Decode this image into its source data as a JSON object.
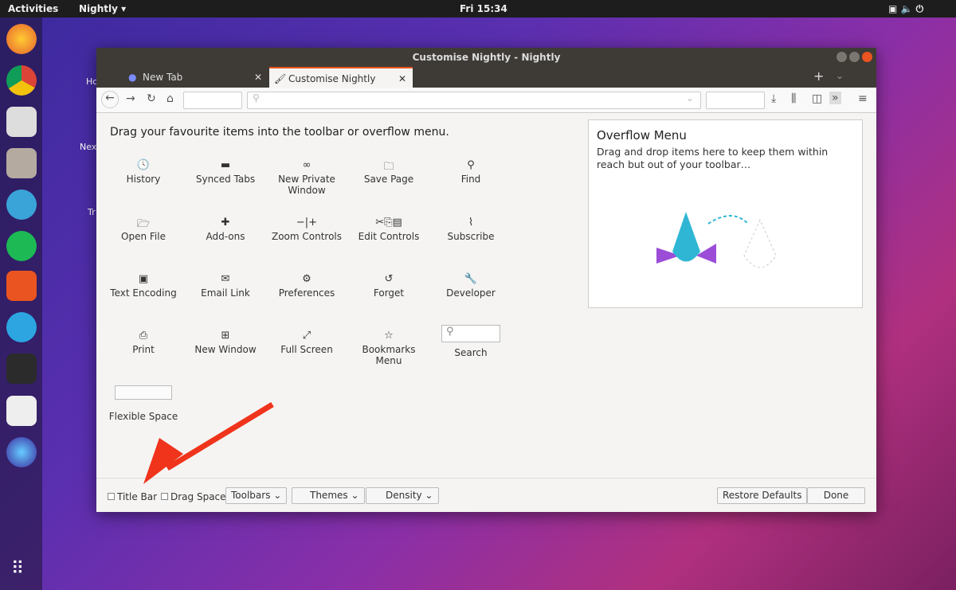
{
  "topbar": {
    "activities": "Activities",
    "app": "Nightly ▾",
    "clock": "Fri 15:34"
  },
  "desktop": {
    "home": "Ho",
    "next": "Nex",
    "trash": "Tr"
  },
  "window": {
    "title": "Customise Nightly - Nightly"
  },
  "tabs": [
    {
      "label": "New Tab"
    },
    {
      "label": "Customise Nightly"
    }
  ],
  "hint": "Drag your favourite items into the toolbar or overflow menu.",
  "items": [
    {
      "label": "History",
      "icon": "🕓"
    },
    {
      "label": "Synced Tabs",
      "icon": "▬"
    },
    {
      "label": "New Private Window",
      "icon": "∞"
    },
    {
      "label": "Save Page",
      "icon": "🗀"
    },
    {
      "label": "Find",
      "icon": "⚲"
    },
    {
      "label": "Open File",
      "icon": "🗁"
    },
    {
      "label": "Add-ons",
      "icon": "✚"
    },
    {
      "label": "Zoom Controls",
      "icon": "−|+"
    },
    {
      "label": "Edit Controls",
      "icon": "✂⎘▤"
    },
    {
      "label": "Subscribe",
      "icon": "⌇"
    },
    {
      "label": "Text Encoding",
      "icon": "▣"
    },
    {
      "label": "Email Link",
      "icon": "✉"
    },
    {
      "label": "Preferences",
      "icon": "⚙"
    },
    {
      "label": "Forget",
      "icon": "↺"
    },
    {
      "label": "Developer",
      "icon": "🔧"
    },
    {
      "label": "Print",
      "icon": "⎙"
    },
    {
      "label": "New Window",
      "icon": "⊞"
    },
    {
      "label": "Full Screen",
      "icon": "⤢"
    },
    {
      "label": "Bookmarks Menu",
      "icon": "☆"
    },
    {
      "label": "Search",
      "icon": "⚲"
    }
  ],
  "flexible": "Flexible Space",
  "overflow": {
    "title": "Overflow Menu",
    "text": "Drag and drop items here to keep them within reach but out of your toolbar…"
  },
  "footer": {
    "titlebar": "Title Bar",
    "dragspace": "Drag Space",
    "toolbars": "Toolbars ⌄",
    "themes": "Themes ⌄",
    "density": "Density ⌄",
    "restore": "Restore Defaults",
    "done": "Done"
  }
}
